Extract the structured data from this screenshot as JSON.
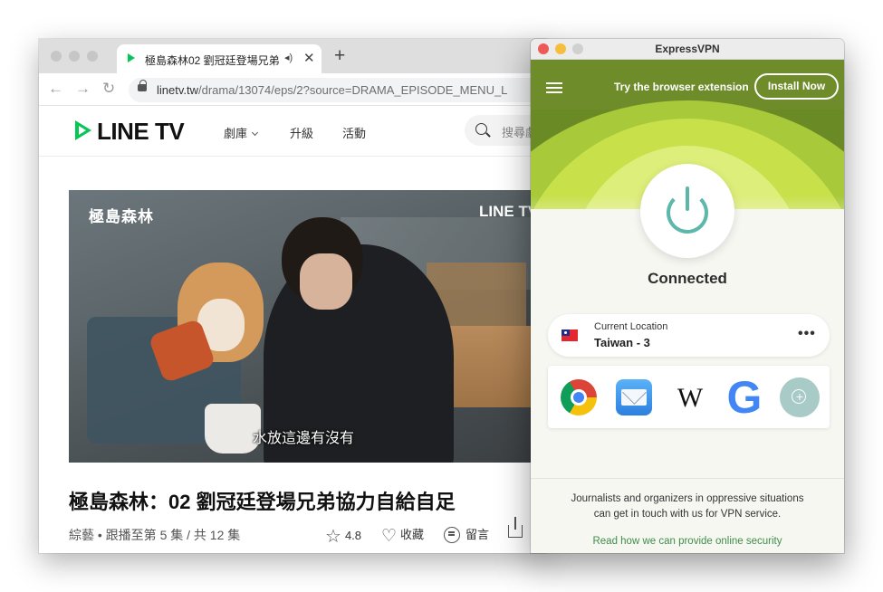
{
  "browser": {
    "tab": {
      "title": "極島森林02 劉冠廷登場兄弟",
      "audio_icon": "audio-icon",
      "close_icon": "close-icon"
    },
    "new_tab_icon": "plus-icon",
    "url_host": "linetv.tw",
    "url_path": "/drama/13074/eps/2?source=DRAMA_EPISODE_MENU_L"
  },
  "site": {
    "logo": "LINE TV",
    "nav": [
      "劇庫",
      "升級",
      "活動"
    ],
    "search_placeholder": "搜尋劇",
    "video": {
      "brand": "極島森林",
      "watermark": "LINE TV",
      "subtitle": "水放這邊有沒有"
    },
    "episode_title": "極島森林：02 劉冠廷登場兄弟協力自給自足",
    "episode_meta": "綜藝 • 跟播至第 5 集 / 共 12 集",
    "rating": "4.8",
    "favorite_label": "收藏",
    "comment_label": "留言"
  },
  "vpn": {
    "window_title": "ExpressVPN",
    "promo_text": "Try the browser extension",
    "install_button": "Install Now",
    "status": "Connected",
    "location_label": "Current Location",
    "location_value": "Taiwan - 3",
    "more_icon": "more-icon",
    "shortcuts": [
      "chrome-icon",
      "mail-icon",
      "wikipedia-icon",
      "google-icon",
      "add-shortcut-icon"
    ],
    "wiki_glyph": "W",
    "google_glyph": "G",
    "info_line1": "Journalists and organizers in oppressive situations",
    "info_line2": "can get in touch with us for VPN service.",
    "info_link": "Read how we can provide online security",
    "colors": {
      "accent": "#5db7ab",
      "hero_dark": "#6f8c2a",
      "hero_light": "#c8e04a",
      "link": "#3e8d4a",
      "line_green": "#06c755"
    }
  }
}
